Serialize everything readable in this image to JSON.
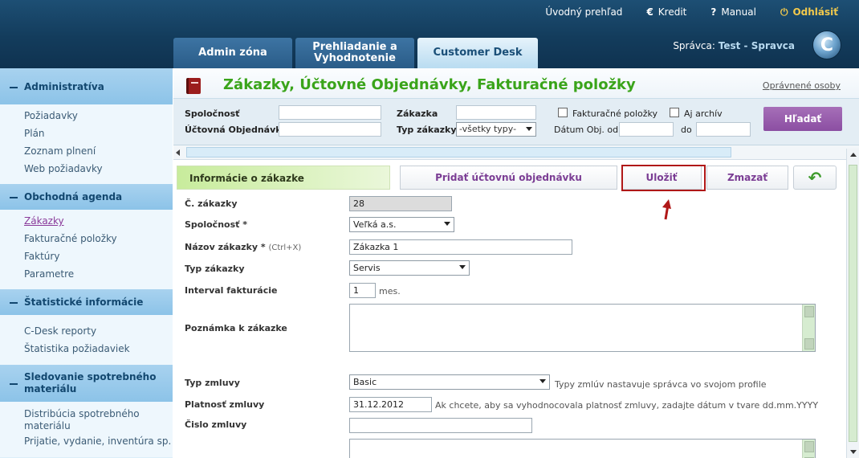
{
  "toplinks": {
    "overview": "Úvodný prehľad",
    "credit": "Kredit",
    "manual": "Manual",
    "logout": "Odhlásiť"
  },
  "tabs": [
    "Admin zóna",
    "Prehliadanie a Vyhodnotenie",
    "Customer Desk"
  ],
  "manager": {
    "label": "Správca:",
    "name": "Test - Spravca"
  },
  "logo_letter": "C",
  "sidebar": {
    "sections": [
      {
        "title": "Administratíva",
        "items": [
          "Požiadavky",
          "Plán",
          "Zoznam plnení",
          "Web požiadavky"
        ]
      },
      {
        "title": "Obchodná agenda",
        "items": [
          "Zákazky",
          "Fakturačné položky",
          "Faktúry",
          "Parametre"
        ]
      },
      {
        "title": "Štatistické informácie",
        "items": [
          "C-Desk reporty",
          "Štatistika požiadaviek"
        ]
      },
      {
        "title": "Sledovanie spotrebného materiálu",
        "items": [
          "Distribúcia spotrebného materiálu",
          "Prijatie, vydanie, inventúra sp."
        ]
      }
    ]
  },
  "page": {
    "title": "Zákazky, Účtovné Objednávky, Fakturačné položky",
    "auth_link": "Oprávnené osoby"
  },
  "filters": {
    "company_label": "Spoločnosť",
    "order_label": "Účtovná Objednávka",
    "contract_label": "Zákazka",
    "type_label": "Typ zákazky",
    "type_value": "-všetky typy-",
    "invoice_items_label": "Fakturačné položky",
    "archive_label": "Aj archív",
    "date_from_label": "Dátum Obj. od",
    "date_to_label": "do",
    "search_button": "Hľadať"
  },
  "form": {
    "section_title": "Informácie o zákazke",
    "add_order_button": "Pridať účtovnú objednávku",
    "save_button": "Uložiť",
    "delete_button": "Zmazať",
    "fields": {
      "number_label": "Č. zákazky",
      "number_value": "28",
      "company_label": "Spoločnosť *",
      "company_value": "Veľká a.s.",
      "name_label": "Názov zákazky *",
      "name_hint": "(Ctrl+X)",
      "name_value": "Zákazka 1",
      "type_label": "Typ zákazky",
      "type_value": "Servis",
      "interval_label": "Interval fakturácie",
      "interval_value": "1",
      "interval_unit": "mes.",
      "note_label": "Poznámka k zákazke",
      "contract_type_label": "Typ zmluvy",
      "contract_type_value": "Basic",
      "contract_type_note": "Typy zmlúv nastavuje správca vo svojom profile",
      "validity_label": "Platnosť zmluvy",
      "validity_value": "31.12.2012",
      "validity_note": "Ak chcete, aby sa vyhodnocovala platnosť zmluvy, zadajte dátum v tvare dd.mm.YYYY",
      "contract_no_label": "Čislo zmluvy"
    }
  },
  "colors": {
    "accent_green": "#3aa41a",
    "purple": "#8b4ea2",
    "header_blue": "#133c5c",
    "annotation_red": "#b01818"
  }
}
